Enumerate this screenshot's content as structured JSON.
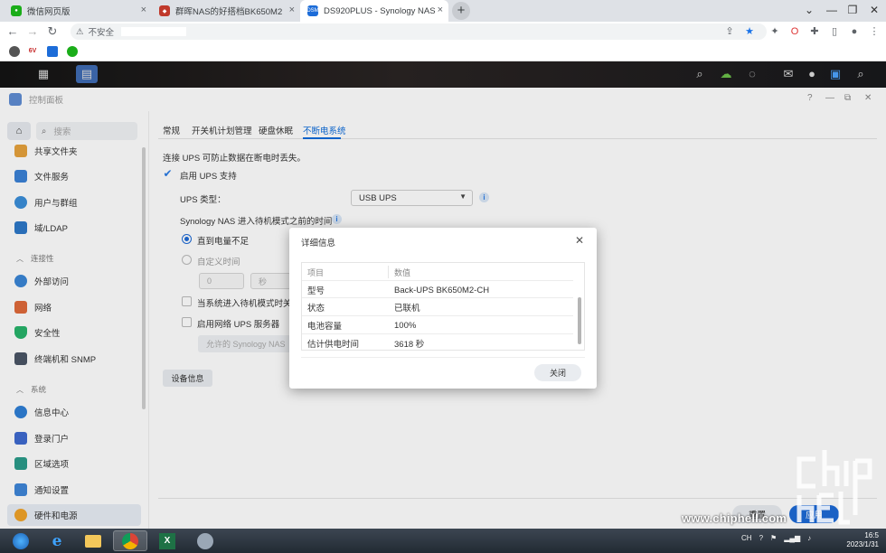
{
  "browser": {
    "tabs": [
      {
        "label": "微信网页版",
        "fav_color": "#1aad19"
      },
      {
        "label": "群晖NAS的好搭档BK650M2-CH",
        "fav_color": "#c0392b"
      },
      {
        "label": "DS920PLUS - Synology NAS",
        "fav_color": "#1c6cd8",
        "fav_text": "DSM"
      }
    ],
    "insecure_label": "不安全",
    "bookmarks": [
      "6V"
    ]
  },
  "cp": {
    "title": "控制面板",
    "window_controls": [
      "?",
      "—",
      "⧉",
      "✕"
    ]
  },
  "sidebar": {
    "search_placeholder": "搜索",
    "items_top": [
      {
        "label": "共享文件夹",
        "color": "#e6a23c"
      },
      {
        "label": "文件服务",
        "color": "#3b82d6"
      },
      {
        "label": "用户与群组",
        "color": "#3b8fd9"
      },
      {
        "label": "域/LDAP",
        "color": "#2d78c8"
      }
    ],
    "group_conn": "连接性",
    "items_conn": [
      {
        "label": "外部访问",
        "color": "#3a86d6"
      },
      {
        "label": "网络",
        "color": "#e06a3a"
      },
      {
        "label": "安全性",
        "color": "#28b36b"
      },
      {
        "label": "终端机和 SNMP",
        "color": "#4a5565"
      }
    ],
    "group_sys": "系统",
    "items_sys": [
      {
        "label": "信息中心",
        "color": "#2f7fd6"
      },
      {
        "label": "登录门户",
        "color": "#3e6ad0"
      },
      {
        "label": "区域选项",
        "color": "#2b9c8a"
      },
      {
        "label": "通知设置",
        "color": "#3e86d8"
      },
      {
        "label": "硬件和电源",
        "color": "#f0a32a"
      }
    ]
  },
  "main": {
    "tabs": [
      "常规",
      "开关机计划管理",
      "硬盘休眠",
      "不断电系统"
    ],
    "active_tab": "不断电系统",
    "intro": "连接 UPS 可防止数据在断电时丢失。",
    "enable_ups": "启用 UPS 支持",
    "ups_type_label": "UPS 类型：",
    "ups_type_value": "USB UPS",
    "standby_label": "Synology NAS 进入待机模式之前的时间",
    "radio_low_battery": "直到电量不足",
    "radio_custom": "自定义时间",
    "custom_value": "0",
    "custom_unit": "秒",
    "shutdown_ups": "当系统进入待机模式时关闭",
    "network_server": "启用网络 UPS 服务器",
    "allowed_button": "允许的 Synology NAS",
    "device_info_button": "设备信息",
    "reset_button": "重置",
    "apply_button": "应用"
  },
  "dialog": {
    "title": "详细信息",
    "col_item": "项目",
    "col_value": "数值",
    "rows": [
      {
        "item": "型号",
        "value": "Back-UPS BK650M2-CH"
      },
      {
        "item": "状态",
        "value": "已联机"
      },
      {
        "item": "电池容量",
        "value": "100%"
      },
      {
        "item": "估计供电时间",
        "value": "3618 秒"
      }
    ],
    "close_button": "关闭"
  },
  "taskbar": {
    "tray": [
      "CH",
      "?"
    ],
    "time": "16:5",
    "date": "2023/1/31"
  },
  "watermark": "www.chiphell.com"
}
